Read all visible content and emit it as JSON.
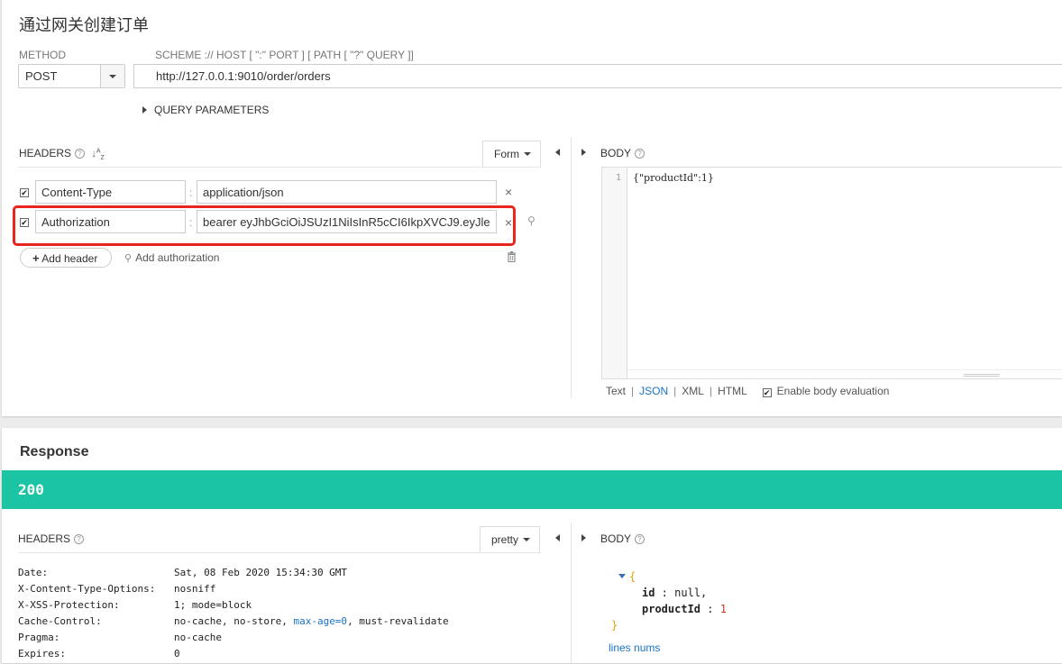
{
  "request": {
    "title": "通过网关创建订单",
    "method_label": "METHOD",
    "url_label": "SCHEME :// HOST [ \":\" PORT ] [ PATH [ \"?\" QUERY ]]",
    "method": "POST",
    "url": "http://127.0.0.1:9010/order/orders",
    "query_params_label": "QUERY PARAMETERS",
    "headers_label": "HEADERS",
    "form_label": "Form",
    "headers": [
      {
        "checked": "✔",
        "name": "Content-Type",
        "value": "application/json"
      },
      {
        "checked": "✔",
        "name": "Authorization",
        "value": "bearer eyJhbGciOiJSUzI1NiIsInR5cCI6IkpXVCJ9.eyJle"
      }
    ],
    "add_header_label": "Add header",
    "add_authorization_label": "Add authorization",
    "body_label": "BODY",
    "body_line_number": "1",
    "body_code": "{\"productId\":1}",
    "format_options": [
      "Text",
      "JSON",
      "XML",
      "HTML"
    ],
    "format_active": "JSON",
    "enable_body_eval_label": "Enable body evaluation",
    "highlight_color": "#e8261e"
  },
  "response": {
    "title": "Response",
    "status_code": "200",
    "status_color": "#1bc5a4",
    "headers_label": "HEADERS",
    "pretty_label": "pretty",
    "body_label": "BODY",
    "headers": [
      {
        "key": "Date:",
        "value": "Sat, 08 Feb 2020 15:34:30 GMT"
      },
      {
        "key": "X-Content-Type-Options:",
        "value": "nosniff"
      },
      {
        "key": "X-XSS-Protection:",
        "value": "1; mode=block"
      },
      {
        "key": "Cache-Control:",
        "value_before": "no-cache, no-store, ",
        "value_link": "max-age=0",
        "value_after": ", must-revalidate"
      },
      {
        "key": "Pragma:",
        "value": "no-cache"
      },
      {
        "key": "Expires:",
        "value": "0"
      }
    ],
    "body_json": {
      "open": "{",
      "fields": [
        {
          "key": "id",
          "sep": " :  ",
          "value": "null",
          "trail": ","
        },
        {
          "key": "productId",
          "sep": " :  ",
          "value": "1",
          "trail": ""
        }
      ],
      "close": "}"
    },
    "lines_nums_label": "lines nums"
  }
}
